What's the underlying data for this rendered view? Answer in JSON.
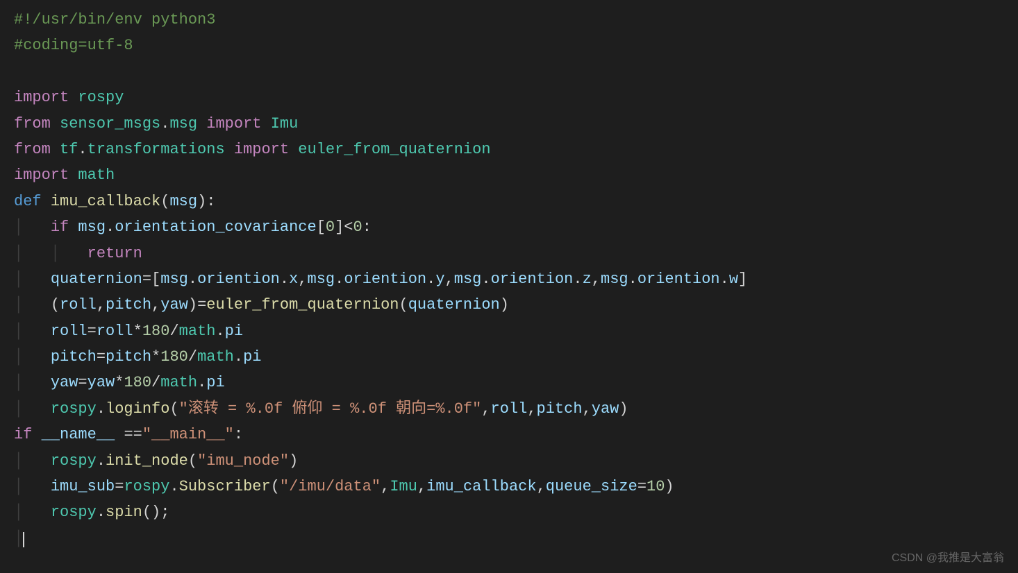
{
  "code": {
    "line1_shebang": "#!/usr/bin/env python3",
    "line2_coding": "#coding=utf-8",
    "import_kw": "import",
    "from_kw": "from",
    "def_kw": "def",
    "if_kw": "if",
    "return_kw": "return",
    "rospy": "rospy",
    "sensor_msgs": "sensor_msgs",
    "msg_mod": "msg",
    "Imu": "Imu",
    "tf": "tf",
    "transformations": "transformations",
    "euler_fn": "euler_from_quaternion",
    "math": "math",
    "imu_callback": "imu_callback",
    "msg_param": "msg",
    "orientation_covariance": "orientation_covariance",
    "zero": "0",
    "quaternion_var": "quaternion",
    "oriention": "oriention",
    "x": "x",
    "y": "y",
    "z": "z",
    "w": "w",
    "roll": "roll",
    "pitch": "pitch",
    "yaw": "yaw",
    "num180": "180",
    "pi": "pi",
    "loginfo": "loginfo",
    "loginfo_str": "\"滚转 = %.0f 俯仰 = %.0f 朝向=%.0f\"",
    "name_dunder": "__name__",
    "main_str": "\"__main__\"",
    "init_node": "init_node",
    "imu_node_str": "\"imu_node\"",
    "imu_sub": "imu_sub",
    "Subscriber": "Subscriber",
    "imu_data_str": "\"/imu/data\"",
    "queue_size": "queue_size",
    "ten": "10",
    "spin": "spin",
    "eq": "==",
    "dot": ".",
    "comma": ",",
    "colon": ":",
    "lparen": "(",
    "rparen": ")",
    "lbracket": "[",
    "rbracket": "]",
    "lt": "<",
    "assign": "=",
    "star": "*",
    "slash": "/",
    "semi": ";"
  },
  "watermark": "CSDN @我推是大富翁"
}
